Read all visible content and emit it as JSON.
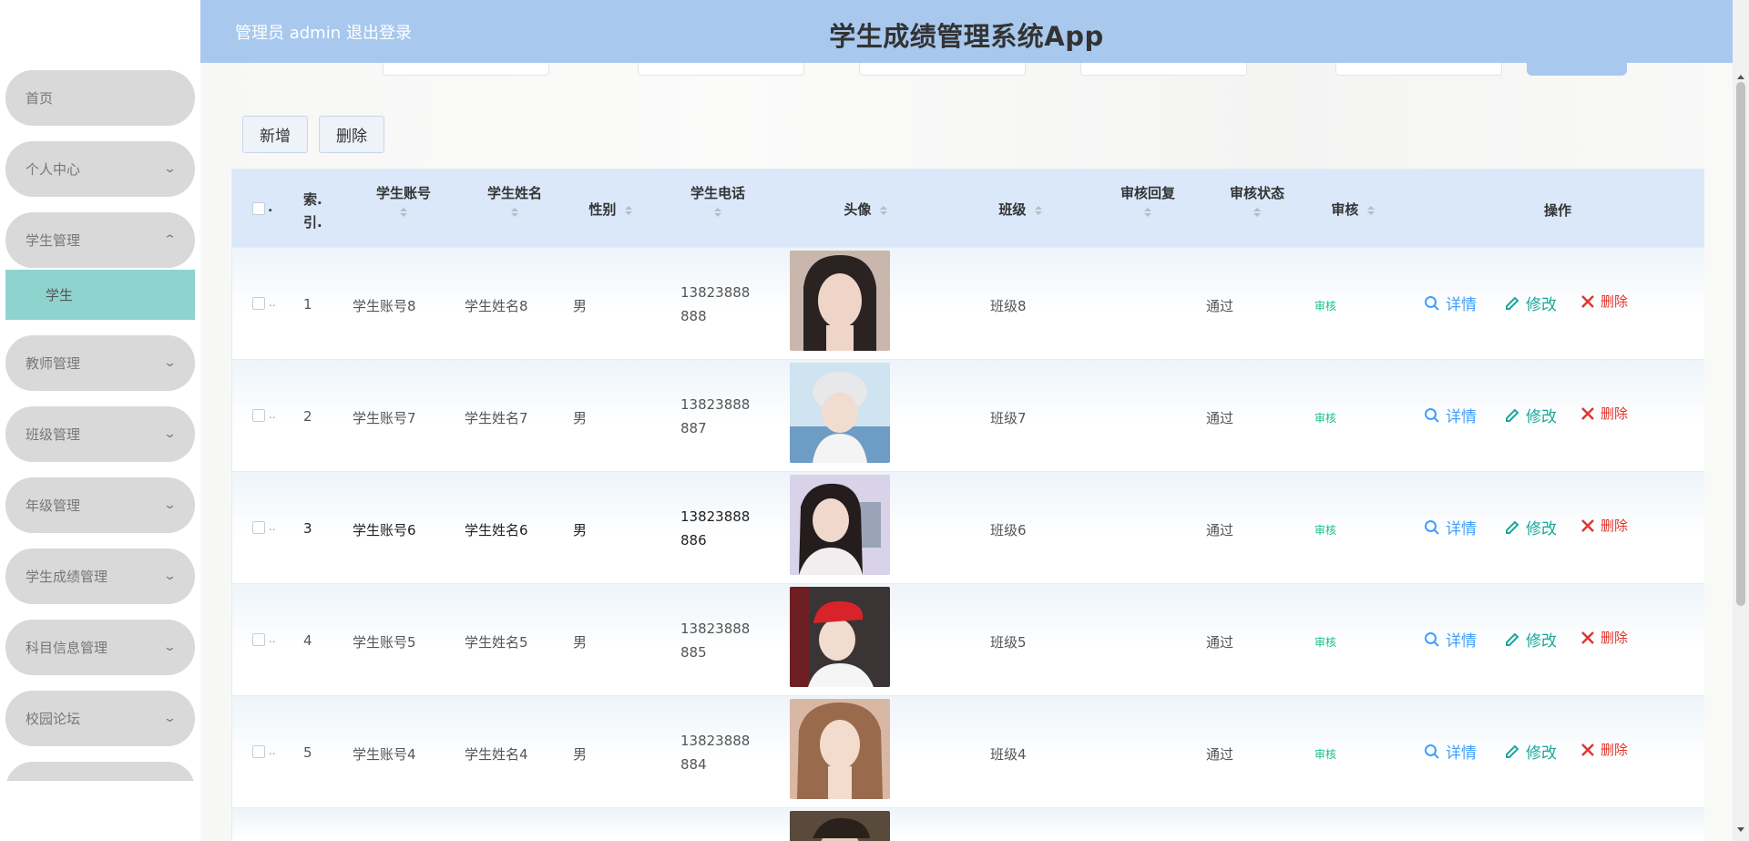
{
  "app": {
    "title": "学生成绩管理系统App",
    "admin_label": "管理员 admin",
    "logout": "退出登录"
  },
  "sidebar": {
    "items": [
      {
        "label": "首页",
        "has_children": false
      },
      {
        "label": "个人中心",
        "has_children": true,
        "expanded": false
      },
      {
        "label": "学生管理",
        "has_children": true,
        "expanded": true,
        "children": [
          "学生"
        ]
      },
      {
        "label": "教师管理",
        "has_children": true,
        "expanded": false
      },
      {
        "label": "班级管理",
        "has_children": true,
        "expanded": false
      },
      {
        "label": "年级管理",
        "has_children": true,
        "expanded": false
      },
      {
        "label": "学生成绩管理",
        "has_children": true,
        "expanded": false
      },
      {
        "label": "科目信息管理",
        "has_children": true,
        "expanded": false
      },
      {
        "label": "校园论坛",
        "has_children": true,
        "expanded": false
      }
    ],
    "active_child": "学生"
  },
  "toolbar": {
    "add_label": "新增",
    "delete_label": "删除"
  },
  "table": {
    "columns": {
      "index": "索.\n引.",
      "account": "学生账号",
      "name": "学生姓名",
      "gender": "性别",
      "phone": "学生电话",
      "avatar": "头像",
      "class": "班级",
      "reply": "审核回复",
      "status": "审核状态",
      "audit": "审核",
      "ops": "操作"
    },
    "rows": [
      {
        "index": "1",
        "account": "学生账号8",
        "name": "学生姓名8",
        "gender": "男",
        "phone_a": "13823888",
        "phone_b": "888",
        "class": "班级8",
        "status": "通过",
        "audit": "审核"
      },
      {
        "index": "2",
        "account": "学生账号7",
        "name": "学生姓名7",
        "gender": "男",
        "phone_a": "13823888",
        "phone_b": "887",
        "class": "班级7",
        "status": "通过",
        "audit": "审核"
      },
      {
        "index": "3",
        "account": "学生账号6",
        "name": "学生姓名6",
        "gender": "男",
        "phone_a": "13823888",
        "phone_b": "886",
        "class": "班级6",
        "status": "通过",
        "audit": "审核"
      },
      {
        "index": "4",
        "account": "学生账号5",
        "name": "学生姓名5",
        "gender": "男",
        "phone_a": "13823888",
        "phone_b": "885",
        "class": "班级5",
        "status": "通过",
        "audit": "审核"
      },
      {
        "index": "5",
        "account": "学生账号4",
        "name": "学生姓名4",
        "gender": "男",
        "phone_a": "13823888",
        "phone_b": "884",
        "class": "班级4",
        "status": "通过",
        "audit": "审核"
      }
    ],
    "ops": {
      "detail": "详情",
      "edit": "修改",
      "delete": "删除"
    }
  },
  "colors": {
    "header_bg": "#a8c8ee",
    "table_head_bg": "#dae8f9",
    "active_submenu": "#8fd3cf",
    "menu_item_bg": "#d9d9d9",
    "detail": "#409eff",
    "edit": "#1aa89a",
    "delete": "#e0362a",
    "audit": "#1bbf8a"
  },
  "icons": {
    "detail": "search-icon",
    "edit": "edit-icon",
    "delete": "close-icon",
    "menu_expand": "chevron-down-icon",
    "menu_collapse": "chevron-up-icon"
  }
}
